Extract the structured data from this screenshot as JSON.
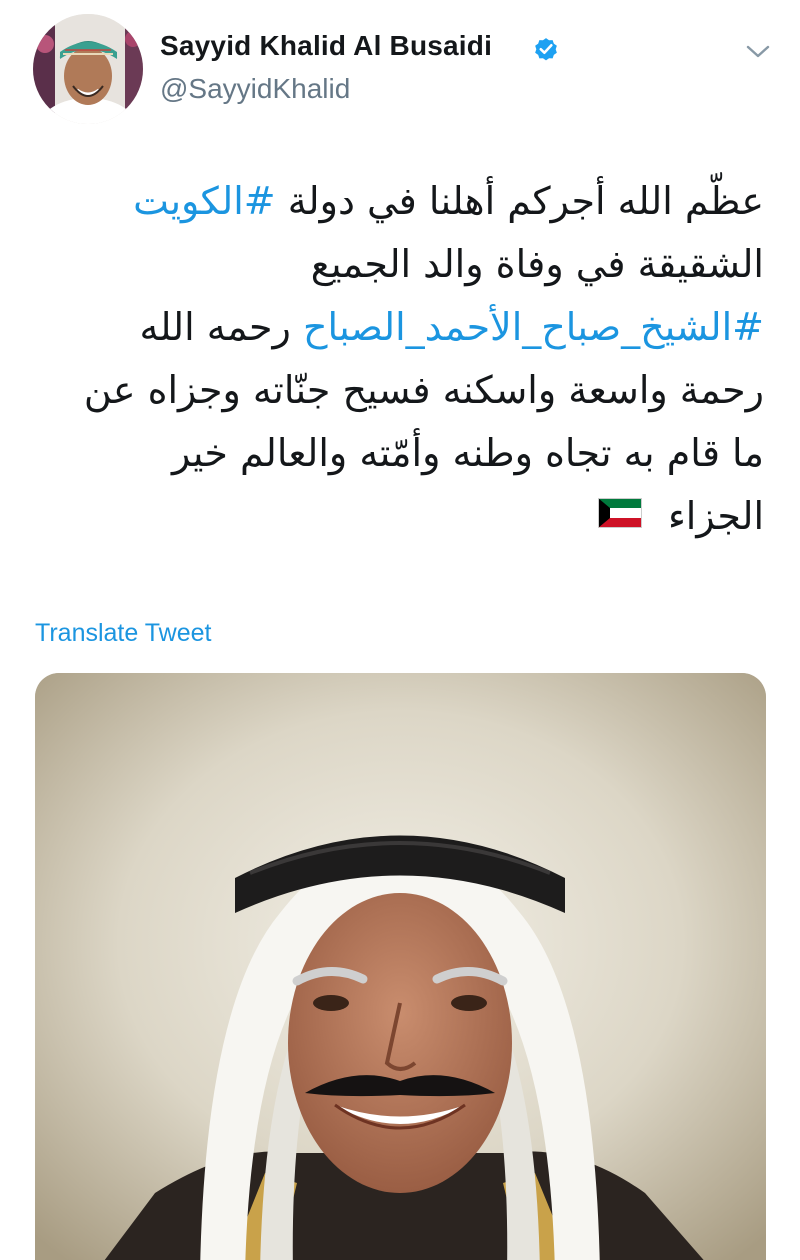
{
  "author": {
    "name": "Sayyid Khalid Al Busaidi",
    "handle": "@SayyidKhalid",
    "verified": true,
    "avatar_icon": "profile-photo"
  },
  "menu_icon": "chevron-down-icon",
  "tweet": {
    "direction": "rtl",
    "lines": [
      {
        "parts": [
          {
            "text": "عظّم الله أجركم أهلنا في دولة "
          },
          {
            "text": "#الكويت",
            "hashtag": true
          }
        ]
      },
      {
        "parts": [
          {
            "text": "الشقيقة في وفاة والد الجميع"
          }
        ]
      },
      {
        "parts": [
          {
            "text": "#الشيخ_صباح_الأحمد_الصباح",
            "hashtag": true
          },
          {
            "text": " رحمه الله"
          }
        ]
      },
      {
        "parts": [
          {
            "text": "رحمة واسعة واسكنه فسيح جنّاته وجزاه عن"
          }
        ]
      },
      {
        "parts": [
          {
            "text": "ما قام به تجاه وطنه وأمّته والعالم خير"
          }
        ]
      },
      {
        "parts": [
          {
            "text": "الجزاء"
          }
        ],
        "emoji": "kuwait-flag"
      }
    ]
  },
  "translate_label": "Translate Tweet",
  "media": {
    "type": "photo",
    "subject": "portrait-photo"
  },
  "colors": {
    "link": "#1b95e0",
    "text": "#14171a",
    "secondary": "#657786",
    "verified": "#1da1f2"
  }
}
